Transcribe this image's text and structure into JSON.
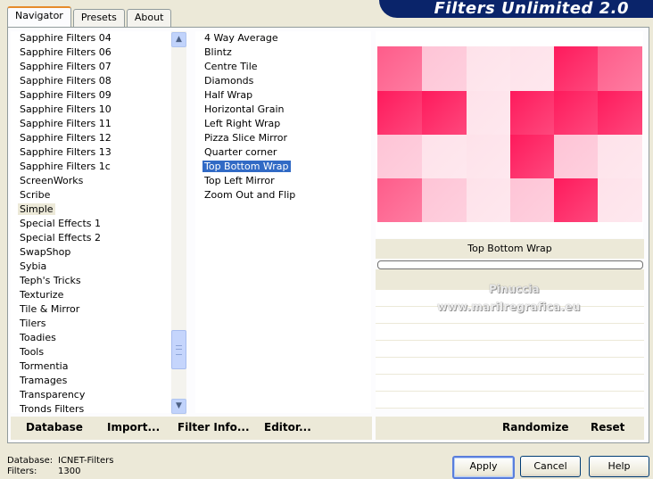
{
  "window": {
    "title": "Filters Unlimited 2.0"
  },
  "tabs": [
    {
      "label": "Navigator"
    },
    {
      "label": "Presets"
    },
    {
      "label": "About"
    }
  ],
  "categories": [
    "Sapphire Filters 04",
    "Sapphire Filters 06",
    "Sapphire Filters 07",
    "Sapphire Filters 08",
    "Sapphire Filters 09",
    "Sapphire Filters 10",
    "Sapphire Filters 11",
    "Sapphire Filters 12",
    "Sapphire Filters 13",
    "Sapphire Filters 1c",
    "ScreenWorks",
    "Scribe",
    "Simple",
    "Special Effects 1",
    "Special Effects 2",
    "SwapShop",
    "Sybia",
    "Teph's Tricks",
    "Texturize",
    "Tile & Mirror",
    "Tilers",
    "Toadies",
    "Tools",
    "Tormentia",
    "Tramages",
    "Transparency",
    "Tronds Filters"
  ],
  "selected_category": "Simple",
  "filters": [
    "4 Way Average",
    "Blintz",
    "Centre Tile",
    "Diamonds",
    "Half Wrap",
    "Horizontal Grain",
    "Left Right Wrap",
    "Pizza Slice Mirror",
    "Quarter corner",
    "Top Bottom Wrap",
    "Top Left Mirror",
    "Zoom Out and Flip"
  ],
  "selected_filter": "Top Bottom Wrap",
  "preview": {
    "filter_name": "Top Bottom Wrap",
    "watermark_line1": "Pinuccia",
    "watermark_line2": "www.marilregrafica.eu",
    "colors": {
      "hot_pink": "#fe1a5c",
      "mid_pink": "#fe5c8a",
      "light_pink": "#fec4d6",
      "pale_pink": "#fee2ea"
    }
  },
  "toolbar_left": {
    "database": "Database",
    "import": "Import...",
    "filter_info": "Filter Info...",
    "editor": "Editor..."
  },
  "toolbar_right": {
    "randomize": "Randomize",
    "reset": "Reset"
  },
  "status": {
    "database_label": "Database:",
    "database_value": "ICNET-Filters",
    "filters_label": "Filters:",
    "filters_value": "1300"
  },
  "buttons": {
    "apply": "Apply",
    "cancel": "Cancel",
    "help": "Help"
  }
}
